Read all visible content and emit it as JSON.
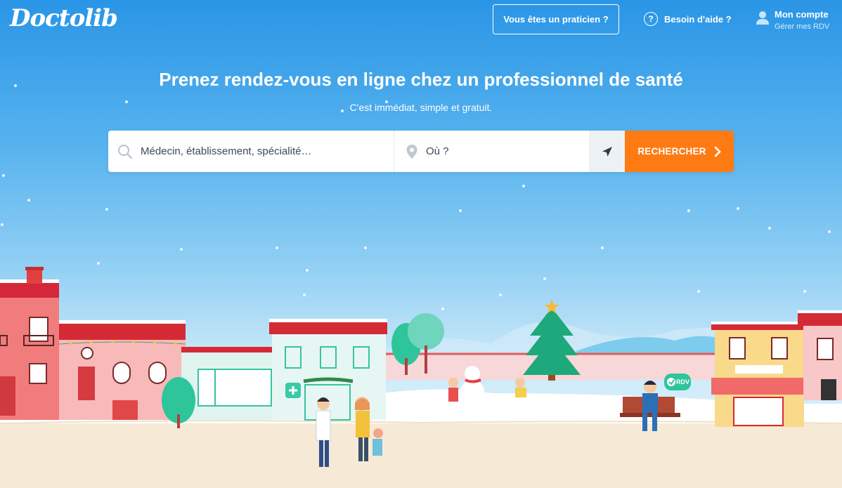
{
  "header": {
    "logo": "Doctolib",
    "pro_button": "Vous êtes un praticien ?",
    "help_label": "Besoin d'aide ?",
    "account_title": "Mon compte",
    "account_subtitle": "Gérer mes RDV"
  },
  "hero": {
    "title": "Prenez rendez-vous en ligne chez un professionnel de santé",
    "subtitle": "C'est immédiat, simple et gratuit."
  },
  "search": {
    "query_placeholder": "Médecin, établissement, spécialité…",
    "location_placeholder": "Où ?",
    "submit_label": "RECHERCHER"
  },
  "illustration": {
    "rdv_badge": "RDV"
  },
  "icons": {
    "search": "search-icon",
    "location": "location-pin-icon",
    "geolocate": "navigation-arrow-icon",
    "help": "question-circle-icon",
    "account": "user-icon",
    "submit": "chevron-right-icon"
  },
  "colors": {
    "brand_blue": "#1f8ee5",
    "cta_orange": "#fe7b14"
  }
}
